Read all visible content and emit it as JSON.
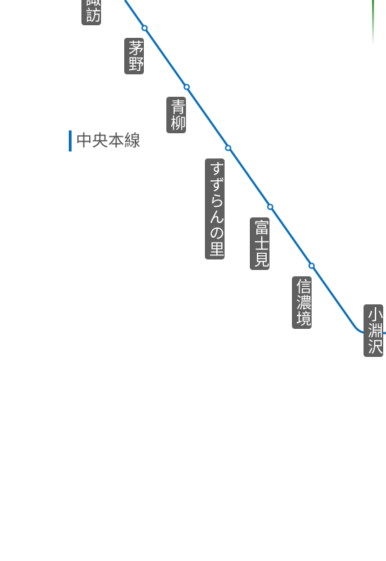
{
  "map": {
    "line": {
      "name": "中央本線",
      "color": "#0b6fba"
    },
    "other_line_color": "#3a9a3a",
    "label_background": "#5f5f5f",
    "stations": [
      {
        "id": "suwa",
        "name": "諏訪"
      },
      {
        "id": "chino",
        "name": "茅野"
      },
      {
        "id": "aoyagi",
        "name": "青柳"
      },
      {
        "id": "suzurannosato",
        "name": "すずらんの里"
      },
      {
        "id": "fujimi",
        "name": "富士見"
      },
      {
        "id": "shinanosakai",
        "name": "信濃境"
      },
      {
        "id": "kobuchizawa",
        "name": "小淵沢"
      }
    ]
  }
}
